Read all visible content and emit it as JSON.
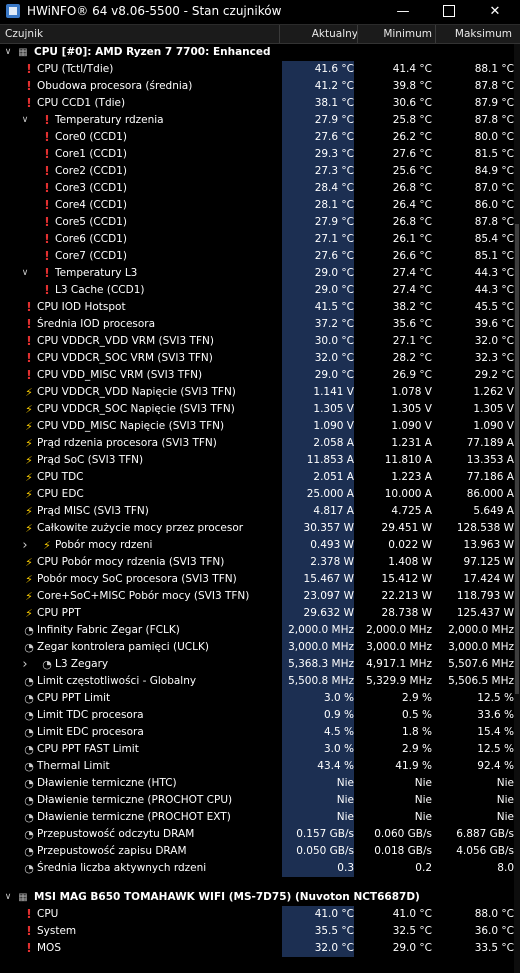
{
  "window": {
    "title": "HWiNFO® 64 v8.06-5500 - Stan czujników",
    "minimize": "—",
    "close": "✕"
  },
  "columns": {
    "name": "Czujnik",
    "current": "Aktualny",
    "minimum": "Minimum",
    "maximum": "Maksimum"
  },
  "rows": [
    {
      "kind": "group",
      "icon": "chip",
      "label": "CPU [#0]: AMD Ryzen 7 7700: Enhanced"
    },
    {
      "icon": "therm",
      "indent": 0,
      "label": "CPU (Tctl/Tdie)",
      "cur": "41.6 °C",
      "min": "41.4 °C",
      "max": "88.1 °C"
    },
    {
      "icon": "therm",
      "indent": 0,
      "label": "Obudowa procesora (średnia)",
      "cur": "41.2 °C",
      "min": "39.8 °C",
      "max": "87.8 °C"
    },
    {
      "icon": "therm",
      "indent": 0,
      "label": "CPU CCD1 (Tdie)",
      "cur": "38.1 °C",
      "min": "30.6 °C",
      "max": "87.9 °C"
    },
    {
      "icon": "therm",
      "indent": 1,
      "expander": "down",
      "label": "Temperatury rdzenia",
      "cur": "27.9 °C",
      "min": "25.8 °C",
      "max": "87.8 °C"
    },
    {
      "icon": "therm",
      "indent": 1,
      "label": "Core0 (CCD1)",
      "cur": "27.6 °C",
      "min": "26.2 °C",
      "max": "80.0 °C"
    },
    {
      "icon": "therm",
      "indent": 1,
      "label": "Core1 (CCD1)",
      "cur": "29.3 °C",
      "min": "27.6 °C",
      "max": "81.5 °C"
    },
    {
      "icon": "therm",
      "indent": 1,
      "label": "Core2 (CCD1)",
      "cur": "27.3 °C",
      "min": "25.6 °C",
      "max": "84.9 °C"
    },
    {
      "icon": "therm",
      "indent": 1,
      "label": "Core3 (CCD1)",
      "cur": "28.4 °C",
      "min": "26.8 °C",
      "max": "87.0 °C"
    },
    {
      "icon": "therm",
      "indent": 1,
      "label": "Core4 (CCD1)",
      "cur": "28.1 °C",
      "min": "26.4 °C",
      "max": "86.0 °C"
    },
    {
      "icon": "therm",
      "indent": 1,
      "label": "Core5 (CCD1)",
      "cur": "27.9 °C",
      "min": "26.8 °C",
      "max": "87.8 °C"
    },
    {
      "icon": "therm",
      "indent": 1,
      "label": "Core6 (CCD1)",
      "cur": "27.1 °C",
      "min": "26.1 °C",
      "max": "85.4 °C"
    },
    {
      "icon": "therm",
      "indent": 1,
      "label": "Core7 (CCD1)",
      "cur": "27.6 °C",
      "min": "26.6 °C",
      "max": "85.1 °C"
    },
    {
      "icon": "therm",
      "indent": 1,
      "expander": "down",
      "label": "Temperatury L3",
      "cur": "29.0 °C",
      "min": "27.4 °C",
      "max": "44.3 °C"
    },
    {
      "icon": "therm",
      "indent": 1,
      "label": "L3 Cache (CCD1)",
      "cur": "29.0 °C",
      "min": "27.4 °C",
      "max": "44.3 °C"
    },
    {
      "icon": "therm",
      "indent": 0,
      "label": "CPU IOD Hotspot",
      "cur": "41.5 °C",
      "min": "38.2 °C",
      "max": "45.5 °C"
    },
    {
      "icon": "therm",
      "indent": 0,
      "label": "Średnia IOD procesora",
      "cur": "37.2 °C",
      "min": "35.6 °C",
      "max": "39.6 °C"
    },
    {
      "icon": "therm",
      "indent": 0,
      "label": "CPU VDDCR_VDD VRM (SVI3 TFN)",
      "cur": "30.0 °C",
      "min": "27.1 °C",
      "max": "32.0 °C"
    },
    {
      "icon": "therm",
      "indent": 0,
      "label": "CPU VDDCR_SOC VRM (SVI3 TFN)",
      "cur": "32.0 °C",
      "min": "28.2 °C",
      "max": "32.3 °C"
    },
    {
      "icon": "therm",
      "indent": 0,
      "label": "CPU VDD_MISC VRM (SVI3 TFN)",
      "cur": "29.0 °C",
      "min": "26.9 °C",
      "max": "29.2 °C"
    },
    {
      "icon": "bolt",
      "indent": 0,
      "label": "CPU VDDCR_VDD Napięcie (SVI3 TFN)",
      "cur": "1.141 V",
      "min": "1.078 V",
      "max": "1.262 V"
    },
    {
      "icon": "bolt",
      "indent": 0,
      "label": "CPU VDDCR_SOC Napięcie (SVI3 TFN)",
      "cur": "1.305 V",
      "min": "1.305 V",
      "max": "1.305 V"
    },
    {
      "icon": "bolt",
      "indent": 0,
      "label": "CPU VDD_MISC Napięcie (SVI3 TFN)",
      "cur": "1.090 V",
      "min": "1.090 V",
      "max": "1.090 V"
    },
    {
      "icon": "bolt",
      "indent": 0,
      "label": "Prąd rdzenia procesora (SVI3 TFN)",
      "cur": "2.058 A",
      "min": "1.231 A",
      "max": "77.189 A"
    },
    {
      "icon": "bolt",
      "indent": 0,
      "label": "Prąd SoC (SVI3 TFN)",
      "cur": "11.853 A",
      "min": "11.810 A",
      "max": "13.353 A"
    },
    {
      "icon": "bolt",
      "indent": 0,
      "label": "CPU TDC",
      "cur": "2.051 A",
      "min": "1.223 A",
      "max": "77.186 A"
    },
    {
      "icon": "bolt",
      "indent": 0,
      "label": "CPU EDC",
      "cur": "25.000 A",
      "min": "10.000 A",
      "max": "86.000 A"
    },
    {
      "icon": "bolt",
      "indent": 0,
      "label": "Prąd MISC (SVI3 TFN)",
      "cur": "4.817 A",
      "min": "4.725 A",
      "max": "5.649 A"
    },
    {
      "icon": "bolt",
      "indent": 0,
      "label": "Całkowite zużycie mocy przez procesor",
      "cur": "30.357 W",
      "min": "29.451 W",
      "max": "128.538 W"
    },
    {
      "icon": "bolt",
      "indent": 1,
      "expander": "right",
      "label": "Pobór mocy rdzeni",
      "cur": "0.493 W",
      "min": "0.022 W",
      "max": "13.963 W"
    },
    {
      "icon": "bolt",
      "indent": 0,
      "label": "CPU Pobór mocy rdzenia (SVI3 TFN)",
      "cur": "2.378 W",
      "min": "1.408 W",
      "max": "97.125 W"
    },
    {
      "icon": "bolt",
      "indent": 0,
      "label": "Pobór mocy SoC procesora (SVI3 TFN)",
      "cur": "15.467 W",
      "min": "15.412 W",
      "max": "17.424 W"
    },
    {
      "icon": "bolt",
      "indent": 0,
      "label": "Core+SoC+MISC Pobór mocy (SVI3 TFN)",
      "cur": "23.097 W",
      "min": "22.213 W",
      "max": "118.793 W"
    },
    {
      "icon": "bolt",
      "indent": 0,
      "label": "CPU PPT",
      "cur": "29.632 W",
      "min": "28.738 W",
      "max": "125.437 W"
    },
    {
      "icon": "clock",
      "indent": 0,
      "label": "Infinity Fabric Zegar (FCLK)",
      "cur": "2,000.0 MHz",
      "min": "2,000.0 MHz",
      "max": "2,000.0 MHz"
    },
    {
      "icon": "clock",
      "indent": 0,
      "label": "Zegar kontrolera pamięci (UCLK)",
      "cur": "3,000.0 MHz",
      "min": "3,000.0 MHz",
      "max": "3,000.0 MHz"
    },
    {
      "icon": "clock",
      "indent": 1,
      "expander": "right",
      "label": "L3 Zegary",
      "cur": "5,368.3 MHz",
      "min": "4,917.1 MHz",
      "max": "5,507.6 MHz"
    },
    {
      "icon": "clock",
      "indent": 0,
      "label": "Limit częstotliwości - Globalny",
      "cur": "5,500.8 MHz",
      "min": "5,329.9 MHz",
      "max": "5,506.5 MHz"
    },
    {
      "icon": "clock",
      "indent": 0,
      "label": "CPU PPT Limit",
      "cur": "3.0 %",
      "min": "2.9 %",
      "max": "12.5 %"
    },
    {
      "icon": "clock",
      "indent": 0,
      "label": "Limit TDC procesora",
      "cur": "0.9 %",
      "min": "0.5 %",
      "max": "33.6 %"
    },
    {
      "icon": "clock",
      "indent": 0,
      "label": "Limit EDC procesora",
      "cur": "4.5 %",
      "min": "1.8 %",
      "max": "15.4 %"
    },
    {
      "icon": "clock",
      "indent": 0,
      "label": "CPU PPT FAST Limit",
      "cur": "3.0 %",
      "min": "2.9 %",
      "max": "12.5 %"
    },
    {
      "icon": "clock",
      "indent": 0,
      "label": "Thermal Limit",
      "cur": "43.4 %",
      "min": "41.9 %",
      "max": "92.4 %"
    },
    {
      "icon": "clock",
      "indent": 0,
      "label": "Dławienie termiczne (HTC)",
      "cur": "Nie",
      "min": "Nie",
      "max": "Nie"
    },
    {
      "icon": "clock",
      "indent": 0,
      "label": "Dławienie termiczne (PROCHOT CPU)",
      "cur": "Nie",
      "min": "Nie",
      "max": "Nie"
    },
    {
      "icon": "clock",
      "indent": 0,
      "label": "Dławienie termiczne (PROCHOT EXT)",
      "cur": "Nie",
      "min": "Nie",
      "max": "Nie"
    },
    {
      "icon": "clock",
      "indent": 0,
      "label": "Przepustowość odczytu DRAM",
      "cur": "0.157 GB/s",
      "min": "0.060 GB/s",
      "max": "6.887 GB/s"
    },
    {
      "icon": "clock",
      "indent": 0,
      "label": "Przepustowość zapisu DRAM",
      "cur": "0.050 GB/s",
      "min": "0.018 GB/s",
      "max": "4.056 GB/s"
    },
    {
      "icon": "clock",
      "indent": 0,
      "label": "Średnia liczba aktywnych rdzeni",
      "cur": "0.3",
      "min": "0.2",
      "max": "8.0"
    },
    {
      "kind": "spacer"
    },
    {
      "kind": "group",
      "icon": "chip",
      "label": "MSI MAG B650 TOMAHAWK WIFI (MS-7D75) (Nuvoton NCT6687D)"
    },
    {
      "icon": "therm",
      "indent": 0,
      "label": "CPU",
      "cur": "41.0 °C",
      "min": "41.0 °C",
      "max": "88.0 °C"
    },
    {
      "icon": "therm",
      "indent": 0,
      "label": "System",
      "cur": "35.5 °C",
      "min": "32.5 °C",
      "max": "36.0 °C"
    },
    {
      "icon": "therm",
      "indent": 0,
      "label": "MOS",
      "cur": "32.0 °C",
      "min": "29.0 °C",
      "max": "33.5 °C"
    }
  ]
}
